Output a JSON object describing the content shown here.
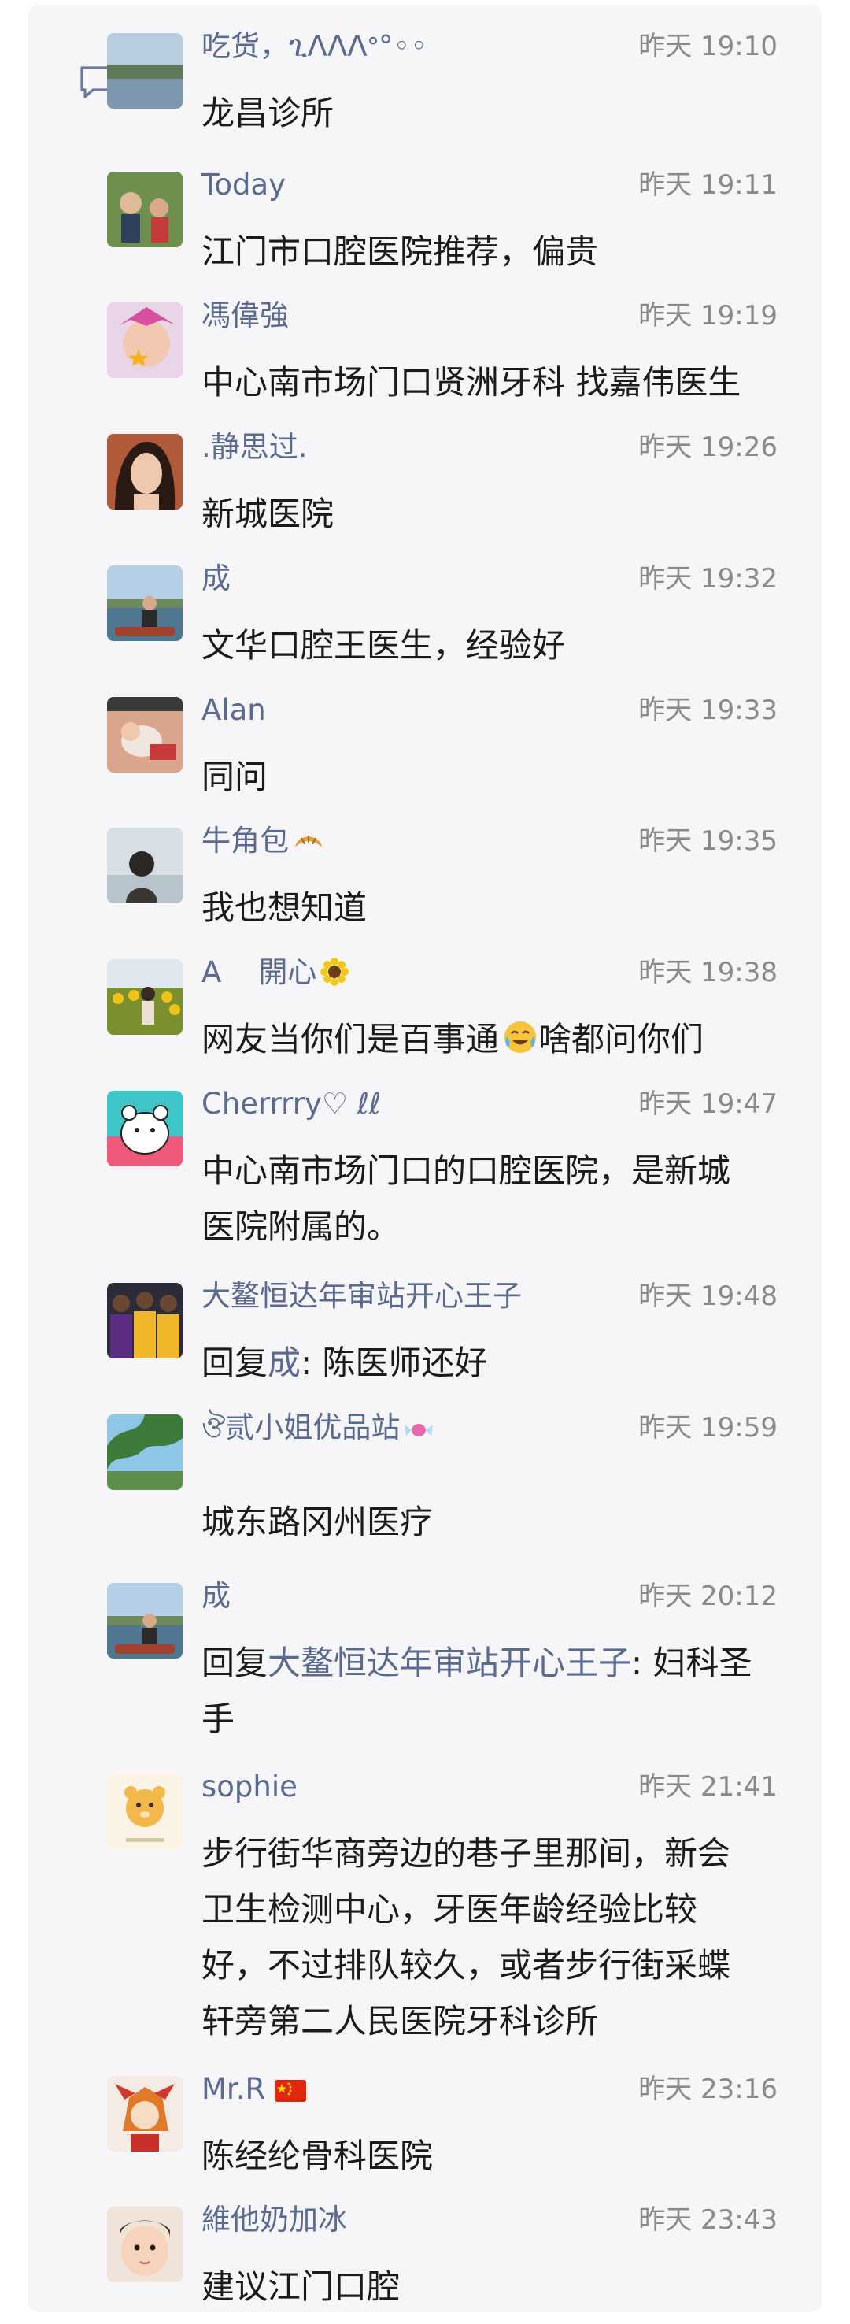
{
  "comments": [
    {
      "name": "吃货，ጊᐱᐱᐱᐤ°◦◦",
      "time": "昨天 19:10",
      "lines": [
        "龙昌诊所"
      ]
    },
    {
      "name": "Today",
      "time": "昨天 19:11",
      "lines": [
        "江门市口腔医院推荐，偏贵"
      ]
    },
    {
      "name": "馮偉強",
      "time": "昨天 19:19",
      "lines": [
        "中心南市场门口贤洲牙科  找嘉伟医生"
      ]
    },
    {
      "name": ".静思过.",
      "time": "昨天 19:26",
      "lines": [
        "新城医院"
      ]
    },
    {
      "name": "成",
      "time": "昨天 19:32",
      "lines": [
        "文华口腔王医生，经验好"
      ]
    },
    {
      "name": "Alan",
      "time": "昨天 19:33",
      "lines": [
        "同问"
      ]
    },
    {
      "name": "牛角包",
      "name_emoji": "croissant-emoji",
      "time": "昨天 19:35",
      "lines": [
        "我也想知道"
      ]
    },
    {
      "name": "A    開心",
      "name_emoji": "sunflower-emoji",
      "time": "昨天 19:38",
      "text_part1": "网友当你们是百事通",
      "text_emoji": "crying-laughing-emoji",
      "text_part2": "啥都问你们"
    },
    {
      "name": "Cherrrry♡ ℓℓ",
      "time": "昨天 19:47",
      "lines": [
        "中心南市场门口的口腔医院，是新城",
        "医院附属的。"
      ]
    },
    {
      "name": "大鳌恒达年审站开心王子",
      "time": "昨天 19:48",
      "reply_prefix": "回复",
      "reply_to": "成",
      "reply_text": ": 陈医师还好"
    },
    {
      "name": "ঔ贰小姐优品站",
      "name_emoji": "candy-emoji",
      "time": "昨天 19:59",
      "lines": [
        "城东路冈州医疗"
      ]
    },
    {
      "name": "成",
      "time": "昨天 20:12",
      "reply_prefix": "回复",
      "reply_to": "大鳌恒达年审站开心王子",
      "reply_text": ": 妇科圣",
      "reply_line2": "手"
    },
    {
      "name": "sophie",
      "time": "昨天 21:41",
      "lines": [
        "步行街华商旁边的巷子里那间，新会",
        "卫生检测中心，牙医年龄经验比较",
        "好，不过排队较久，或者步行街采蝶",
        "轩旁第二人民医院牙科诊所"
      ]
    },
    {
      "name": "Mr.R",
      "name_emoji": "china-flag-emoji",
      "time": "昨天 23:16",
      "lines": [
        "陈经纶骨科医院"
      ]
    },
    {
      "name": "維他奶加冰",
      "time": "昨天 23:43",
      "lines": [
        "建议江门口腔"
      ]
    }
  ],
  "colors": {
    "name": "#5a6a91",
    "time": "#8a8a8a",
    "text": "#1b1b1b",
    "panel": "#f6f6f8"
  }
}
